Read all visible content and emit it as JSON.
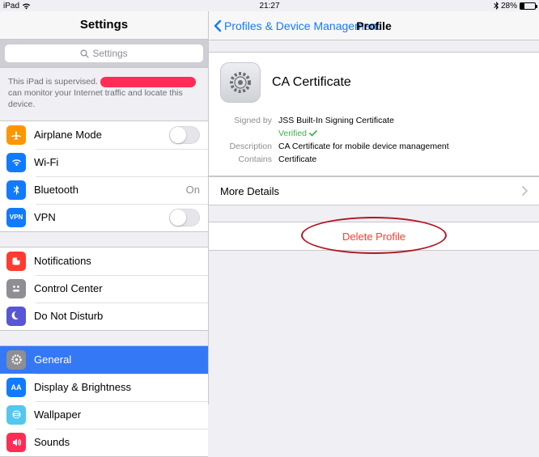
{
  "statusbar": {
    "carrier": "iPad",
    "time": "21:27",
    "battery_pct": "28%"
  },
  "sidebar": {
    "title": "Settings",
    "search_placeholder": "Settings",
    "supervise_prefix": "This iPad is supervised.",
    "supervise_suffix": "can monitor your Internet traffic and locate this device.",
    "group1": [
      {
        "label": "Airplane Mode",
        "side": "",
        "toggle": true
      },
      {
        "label": "Wi-Fi",
        "side": ""
      },
      {
        "label": "Bluetooth",
        "side": "On"
      },
      {
        "label": "VPN",
        "side": "",
        "toggle": true
      }
    ],
    "group2": [
      {
        "label": "Notifications"
      },
      {
        "label": "Control Center"
      },
      {
        "label": "Do Not Disturb"
      }
    ],
    "group3": [
      {
        "label": "General"
      },
      {
        "label": "Display & Brightness"
      },
      {
        "label": "Wallpaper"
      },
      {
        "label": "Sounds"
      }
    ]
  },
  "detail": {
    "back_label": "Profiles & Device Management",
    "title": "Profile",
    "profile_name": "CA Certificate",
    "signed_by_label": "Signed by",
    "signed_by_value": "JSS Built-In Signing Certificate",
    "verified_label": "Verified",
    "description_label": "Description",
    "description_value": "CA Certificate for mobile device management",
    "contains_label": "Contains",
    "contains_value": "Certificate",
    "more_details": "More Details",
    "delete": "Delete Profile"
  }
}
